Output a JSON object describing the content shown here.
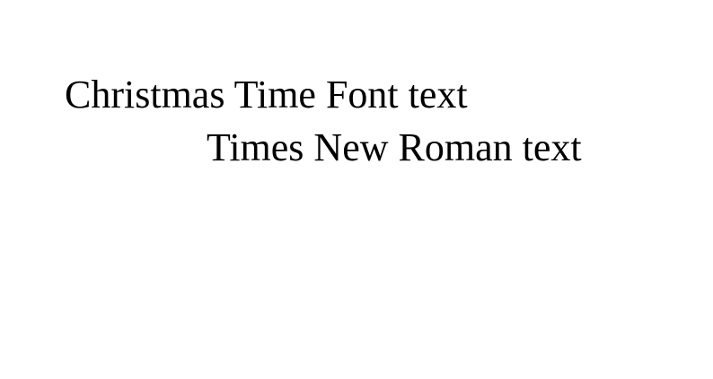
{
  "lines": [
    "Christmas Time Font text",
    "Times New Roman text"
  ],
  "colors": {
    "background": "#ffffff",
    "text": "#000000"
  }
}
